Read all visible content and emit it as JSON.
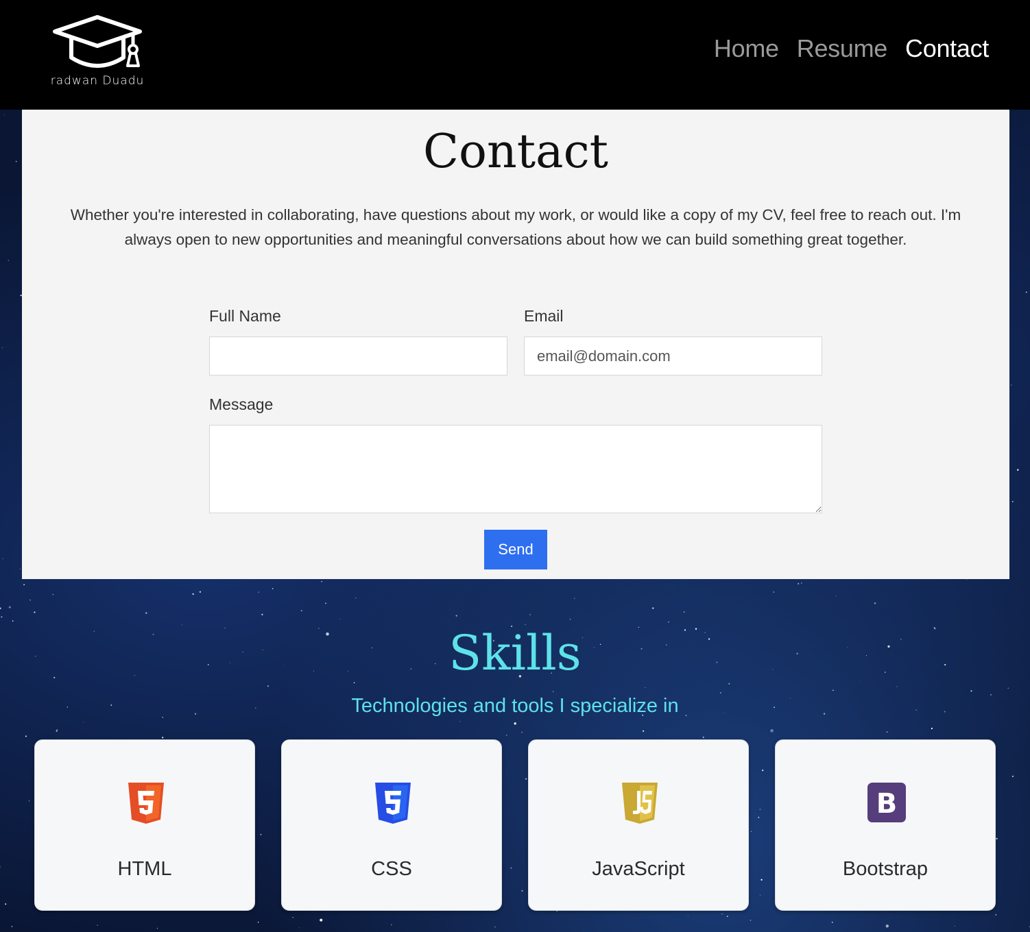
{
  "navbar": {
    "logo_text": "radwan Duadu",
    "links": [
      {
        "label": "Home",
        "active": false
      },
      {
        "label": "Resume",
        "active": false
      },
      {
        "label": "Contact",
        "active": true
      }
    ]
  },
  "contact": {
    "title": "Contact",
    "intro": "Whether you're interested in collaborating, have questions about my work, or would like a copy of my CV, feel free to reach out. I'm always open to new opportunities and meaningful conversations about how we can build something great together.",
    "form": {
      "full_name_label": "Full Name",
      "full_name_value": "",
      "email_label": "Email",
      "email_placeholder": "email@domain.com",
      "message_label": "Message",
      "message_value": "",
      "send_label": "Send"
    }
  },
  "skills": {
    "title": "Skills",
    "subtitle": "Technologies and tools I specialize in",
    "items": [
      {
        "name": "HTML",
        "icon": "html5-icon",
        "color": "#e44d26"
      },
      {
        "name": "CSS",
        "icon": "css3-icon",
        "color": "#264de4"
      },
      {
        "name": "JavaScript",
        "icon": "js-icon",
        "color": "#d4b63c"
      },
      {
        "name": "Bootstrap",
        "icon": "bootstrap-icon",
        "color": "#563d7c"
      }
    ]
  },
  "colors": {
    "accent_button": "#2e6ff0",
    "skills_heading": "#5ee2ea",
    "navbar_bg": "#000000",
    "panel_bg": "#f4f4f4"
  }
}
